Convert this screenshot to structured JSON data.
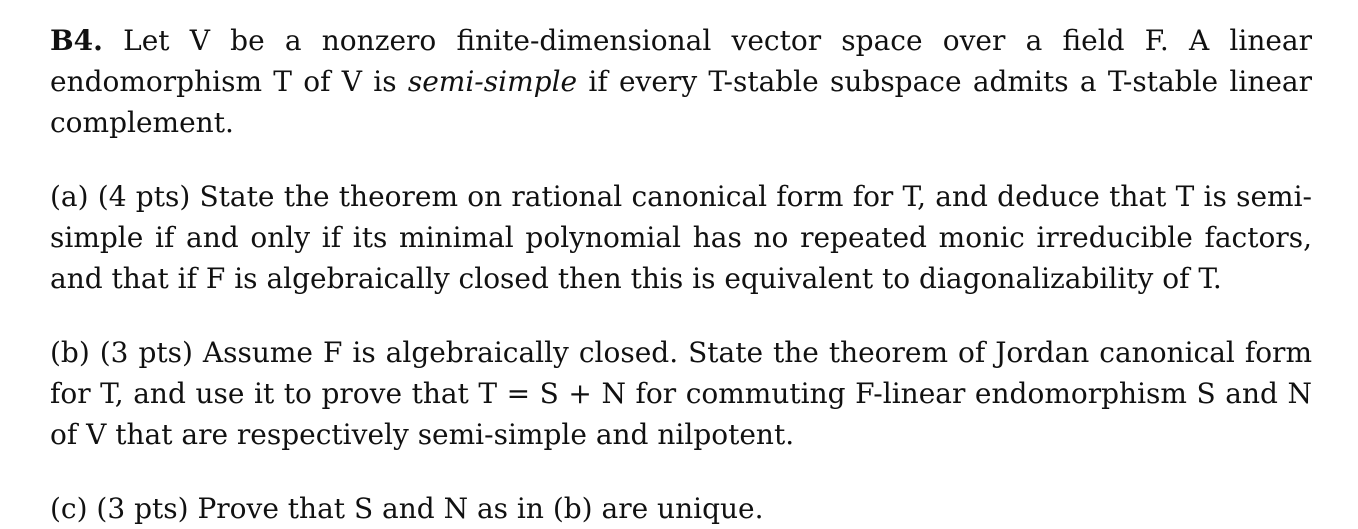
{
  "problem": {
    "label": "B4.",
    "intro_1": " Let V be a nonzero finite-dimensional vector space over a field F. A linear endomorphism T of V is ",
    "intro_emph": "semi-simple",
    "intro_2": " if every T-stable subspace admits a T-stable linear complement."
  },
  "parts": [
    {
      "text": "(a) (4 pts) State the theorem on rational canonical form for T, and deduce that T is semi-simple if and only if its minimal polynomial has no repeated monic irreducible factors, and that if F is algebraically closed then this is equivalent to diagonalizability of T."
    },
    {
      "text": "(b) (3 pts) Assume F is algebraically closed. State the theorem of Jordan canonical form for T, and use it to prove that T = S + N for commuting F-linear endomorphism S and N of V that are respectively semi-simple and nilpotent."
    },
    {
      "text": "(c) (3 pts) Prove that S and N as in (b) are unique."
    }
  ]
}
